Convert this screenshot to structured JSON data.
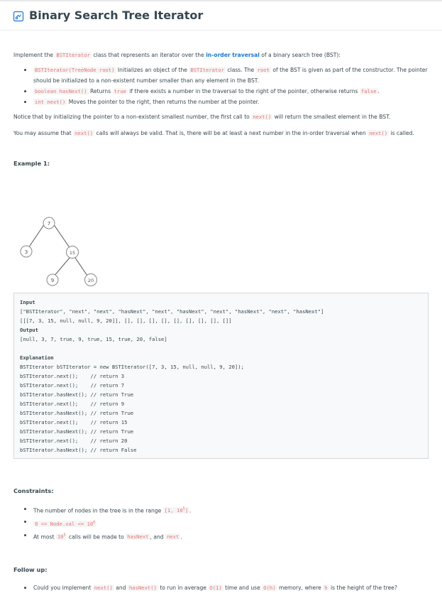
{
  "title": "Binary Search Tree Iterator",
  "intro": {
    "p1_pre": "Implement the ",
    "p1_code": "BSTIterator",
    "p1_mid": " class that represents an iterator over the ",
    "p1_link": "in-order traversal",
    "p1_post": " of a binary search tree (BST):"
  },
  "bullets": [
    {
      "code": "BSTIterator(TreeNode root)",
      "text1": " Initializes an object of the ",
      "code2": "BSTIterator",
      "text2": " class. The ",
      "code3": "root",
      "text3": " of the BST is given as part of the constructor. The pointer should be initialized to a non-existent number smaller than any element in the BST."
    },
    {
      "code": "boolean hasNext()",
      "text1": " Returns ",
      "code2": "true",
      "text2": " if there exists a number in the traversal to the right of the pointer, otherwise returns ",
      "code3": "false",
      "text3": "."
    },
    {
      "code": "int next()",
      "text1": " Moves the pointer to the right, then returns the number at the pointer."
    }
  ],
  "notice": {
    "pre": "Notice that by initializing the pointer to a non-existent smallest number, the first call to ",
    "code": "next()",
    "post": " will return the smallest element in the BST."
  },
  "assume": {
    "pre": "You may assume that ",
    "code": "next()",
    "mid": " calls will always be valid. That is, there will be at least a next number in the in-order traversal when ",
    "code2": "next()",
    "post": " is called."
  },
  "example_title": "Example 1:",
  "tree": {
    "nodes": [
      "7",
      "3",
      "15",
      "9",
      "20"
    ]
  },
  "example_box": {
    "input_label": "Input",
    "input_line1": "[\"BSTIterator\", \"next\", \"next\", \"hasNext\", \"next\", \"hasNext\", \"next\", \"hasNext\", \"next\", \"hasNext\"]",
    "input_line2": "[[[7, 3, 15, null, null, 9, 20]], [], [], [], [], [], [], [], [], []]",
    "output_label": "Output",
    "output_line": "[null, 3, 7, true, 9, true, 15, true, 20, false]",
    "explanation_label": "Explanation",
    "explanation_lines": [
      "BSTIterator bSTIterator = new BSTIterator([7, 3, 15, null, null, 9, 20]);",
      "bSTIterator.next();    // return 3",
      "bSTIterator.next();    // return 7",
      "bSTIterator.hasNext(); // return True",
      "bSTIterator.next();    // return 9",
      "bSTIterator.hasNext(); // return True",
      "bSTIterator.next();    // return 15",
      "bSTIterator.hasNext(); // return True",
      "bSTIterator.next();    // return 20",
      "bSTIterator.hasNext(); // return False"
    ]
  },
  "constraints_title": "Constraints:",
  "constraints": [
    {
      "pre": "The number of nodes in the tree is in the range ",
      "code": "[1, 10",
      "sup": "5",
      "code_end": "]",
      "post": "."
    },
    {
      "code": "0 <= Node.val <= 10",
      "sup": "6"
    },
    {
      "pre": "At most ",
      "code": "10",
      "sup": "5",
      "mid": " calls will be made to ",
      "code2": "hasNext",
      "mid2": ", and ",
      "code3": "next",
      "post": "."
    }
  ],
  "followup_title": "Follow up:",
  "followup": {
    "pre": "Could you implement ",
    "code1": "next()",
    "and": " and ",
    "code2": "hasNext()",
    "mid": " to run in average ",
    "code3": "O(1)",
    "mid2": " time and use ",
    "code4": "O(h)",
    "mid3": " memory, where ",
    "code5": "h",
    "post": " is the height of the tree?"
  },
  "colors": {
    "code_text": "#e57373",
    "link": "#1976d2",
    "text": "#37474f"
  }
}
